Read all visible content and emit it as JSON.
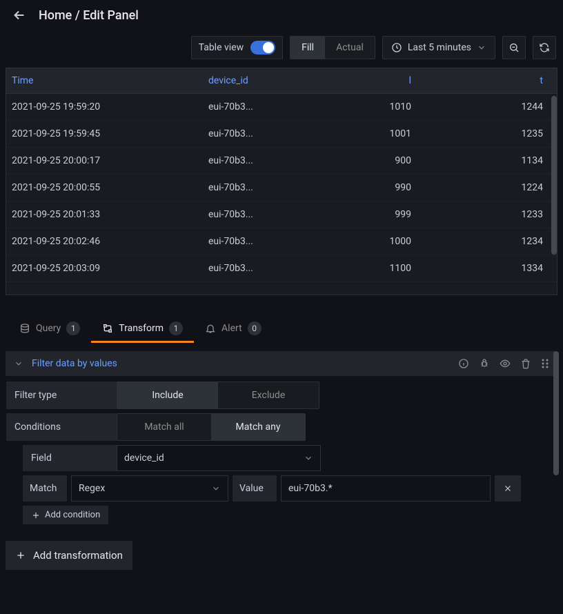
{
  "breadcrumb": "Home / Edit Panel",
  "toolbar": {
    "table_view_label": "Table view",
    "fill_label": "Fill",
    "actual_label": "Actual",
    "time_range": "Last 5 minutes"
  },
  "table": {
    "columns": [
      "Time",
      "device_id",
      "l",
      "t"
    ],
    "rows": [
      {
        "time": "2021-09-25 19:59:20",
        "device_id": "eui-70b3...",
        "l": "1010",
        "t": "1244"
      },
      {
        "time": "2021-09-25 19:59:45",
        "device_id": "eui-70b3...",
        "l": "1001",
        "t": "1235"
      },
      {
        "time": "2021-09-25 20:00:17",
        "device_id": "eui-70b3...",
        "l": "900",
        "t": "1134"
      },
      {
        "time": "2021-09-25 20:00:55",
        "device_id": "eui-70b3...",
        "l": "990",
        "t": "1224"
      },
      {
        "time": "2021-09-25 20:01:33",
        "device_id": "eui-70b3...",
        "l": "999",
        "t": "1233"
      },
      {
        "time": "2021-09-25 20:02:46",
        "device_id": "eui-70b3...",
        "l": "1000",
        "t": "1234"
      },
      {
        "time": "2021-09-25 20:03:09",
        "device_id": "eui-70b3...",
        "l": "1100",
        "t": "1334"
      }
    ]
  },
  "tabs": {
    "query": {
      "label": "Query",
      "count": "1"
    },
    "transform": {
      "label": "Transform",
      "count": "1"
    },
    "alert": {
      "label": "Alert",
      "count": "0"
    }
  },
  "transform": {
    "title": "Filter data by values",
    "filter_type_label": "Filter type",
    "include_label": "Include",
    "exclude_label": "Exclude",
    "conditions_label": "Conditions",
    "match_all_label": "Match all",
    "match_any_label": "Match any",
    "field_label": "Field",
    "field_value": "device_id",
    "match_label": "Match",
    "match_value": "Regex",
    "value_label": "Value",
    "value_input": "eui-70b3.*",
    "add_condition_label": "Add condition",
    "add_transformation_label": "Add transformation"
  }
}
